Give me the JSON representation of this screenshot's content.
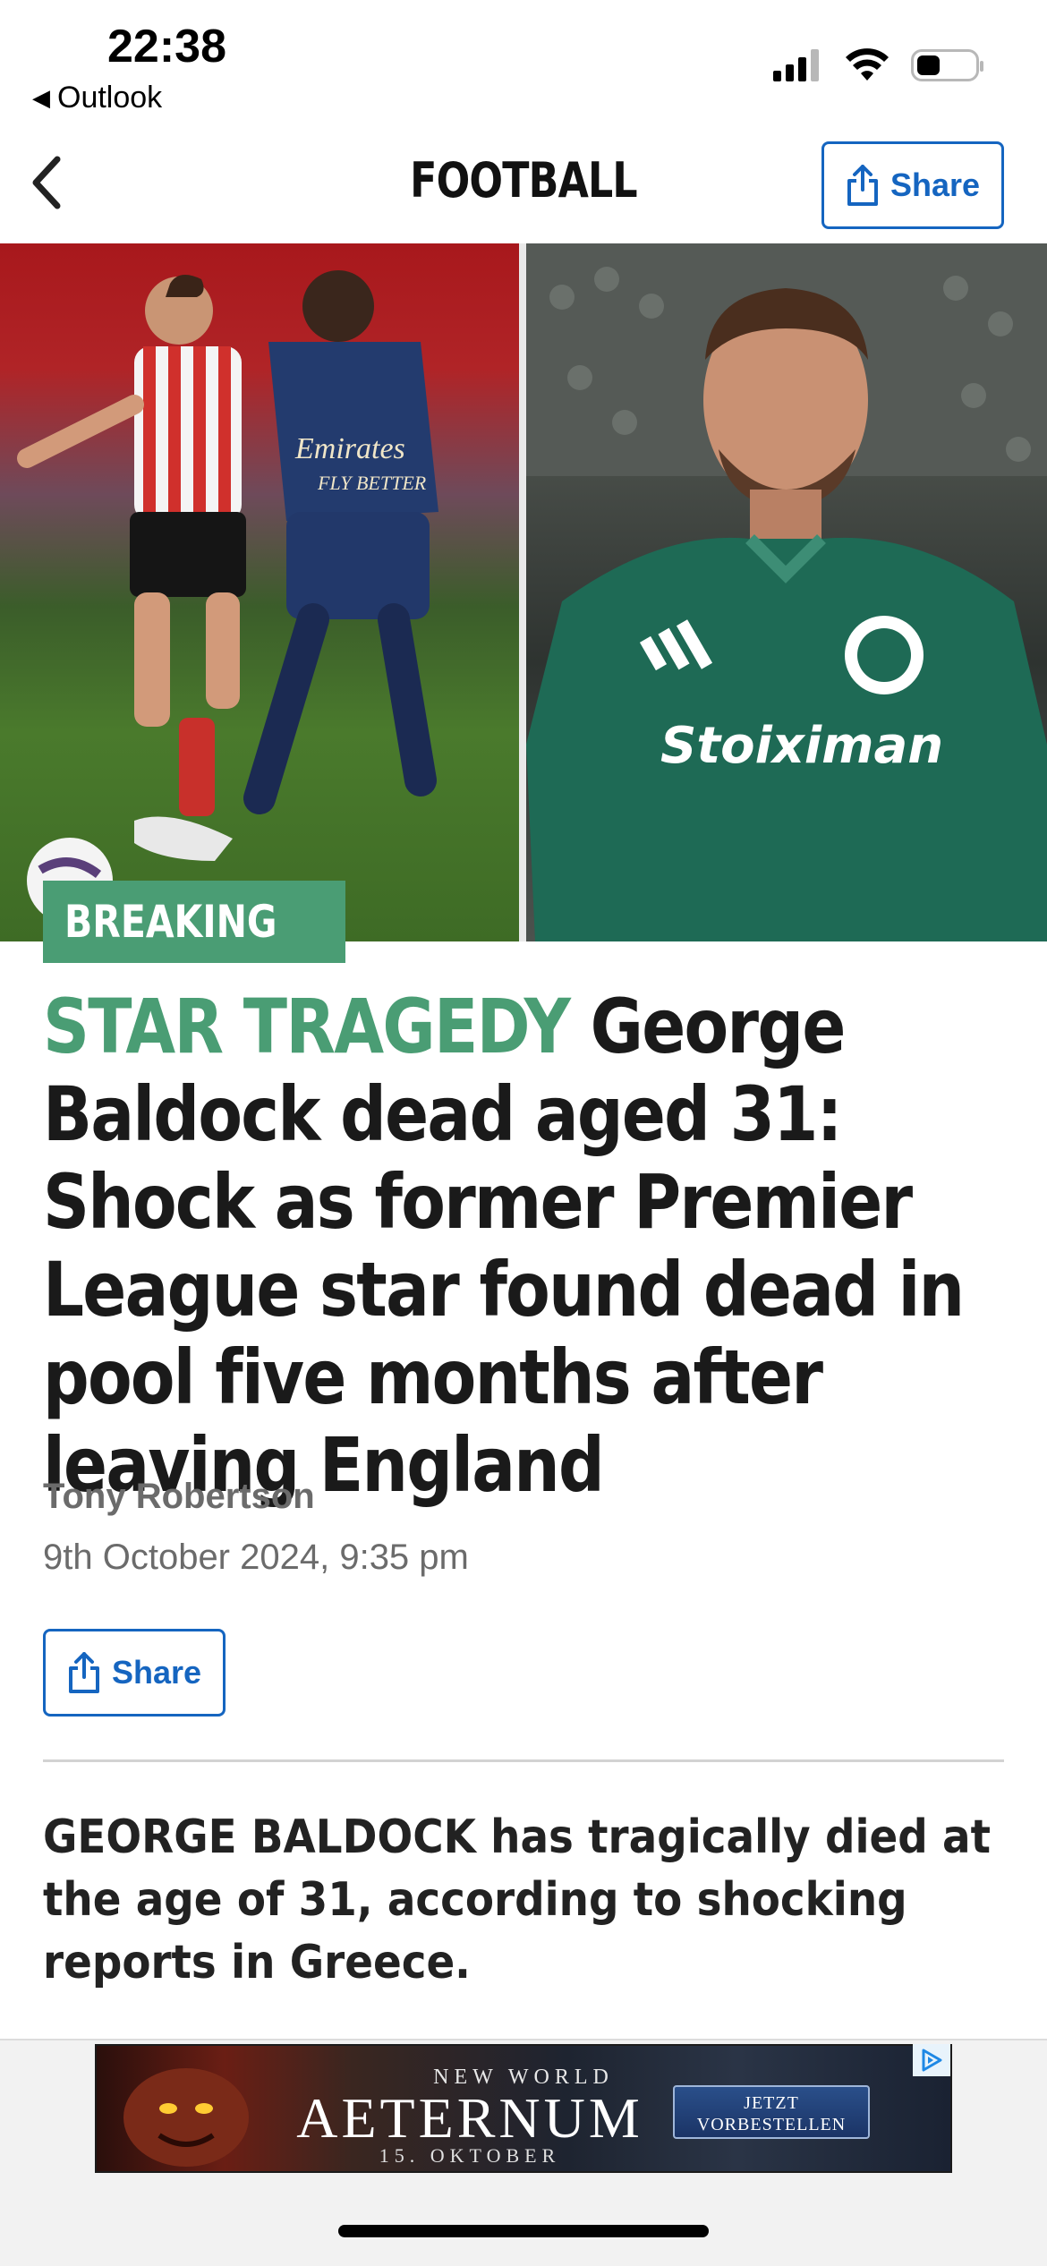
{
  "status_bar": {
    "time": "22:38",
    "back_app": "Outlook",
    "battery_level_fraction": 0.4
  },
  "nav": {
    "title": "FOOTBALL",
    "share_label": "Share"
  },
  "article": {
    "badge": "BREAKING",
    "kicker": "STAR TRAGEDY",
    "headline": "George Baldock dead aged 31: Shock as former Premier League star found dead in pool five months after leaving England",
    "author": "Tony Robertson",
    "date": "9th October 2024, 9:35 pm",
    "share_label": "Share",
    "lede": "GEORGE BALDOCK has tragically died at the age of 31, according to shocking reports in Greece."
  },
  "ad": {
    "brand_top": "NEW WORLD",
    "brand": "AETERNUM",
    "date": "15. OKTOBER",
    "cta_line1": "JETZT",
    "cta_line2": "VORBESTELLEN"
  },
  "colors": {
    "accent_green": "#4a9d74",
    "link_blue": "#1565c0"
  }
}
